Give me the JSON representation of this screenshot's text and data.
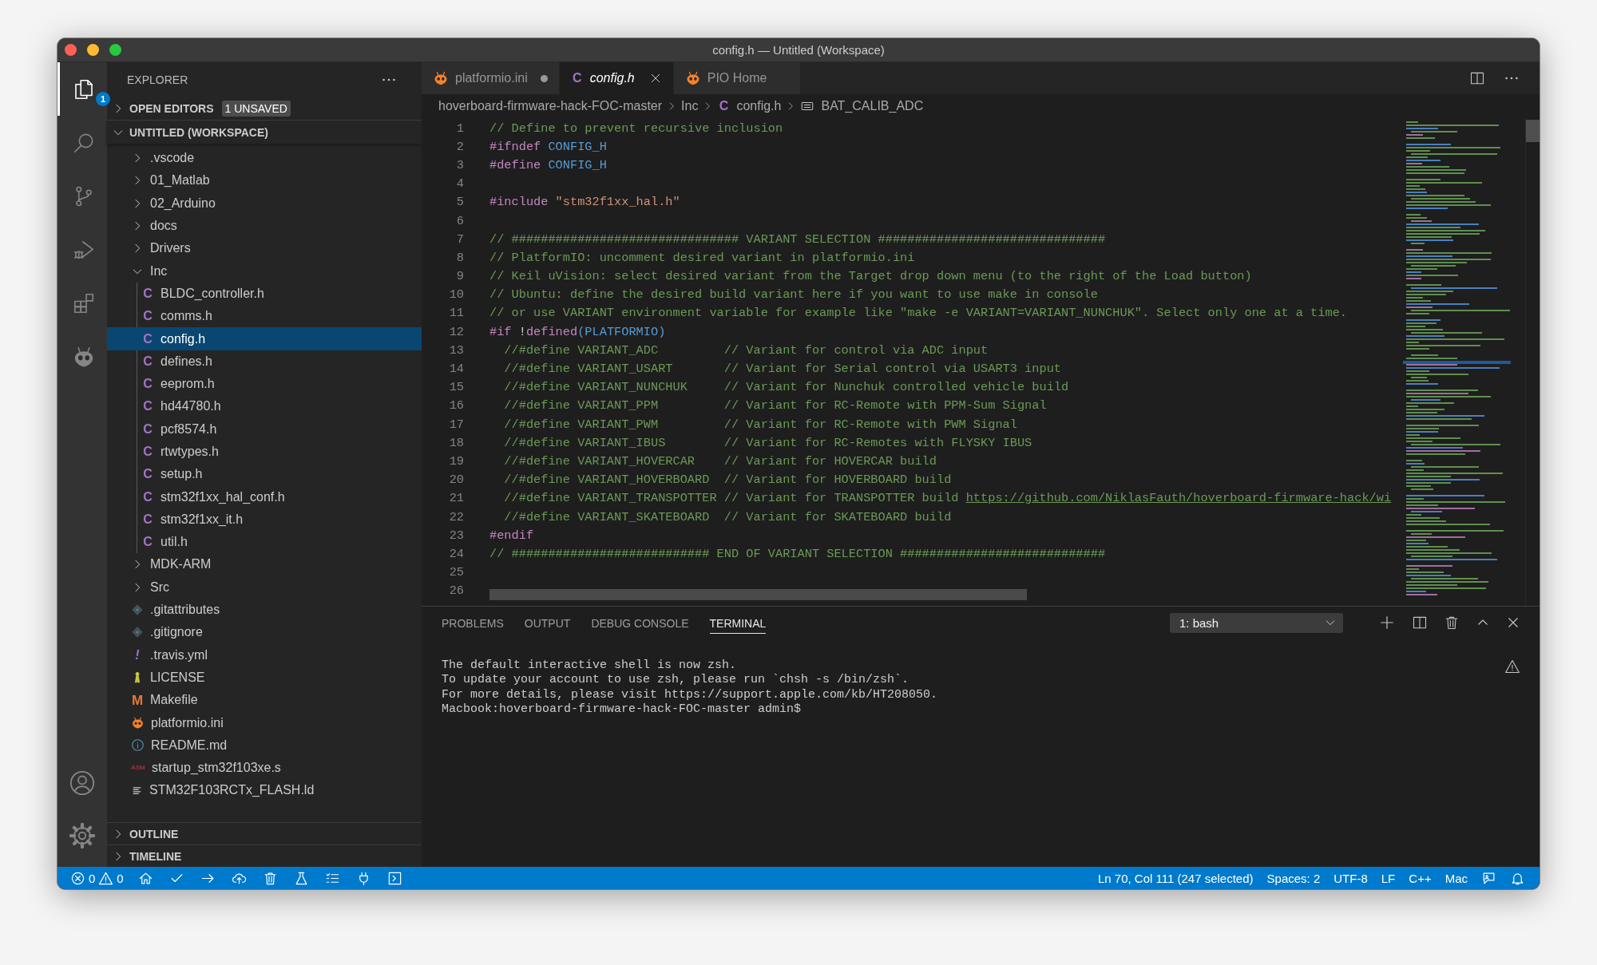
{
  "window": {
    "title": "config.h — Untitled (Workspace)"
  },
  "activity_bar": {
    "items": [
      {
        "kind": "files",
        "selected": true,
        "badge": "1"
      },
      {
        "kind": "search",
        "selected": false
      },
      {
        "kind": "branch",
        "selected": false
      },
      {
        "kind": "debug",
        "selected": false
      },
      {
        "kind": "extensions",
        "selected": false
      },
      {
        "kind": "alien",
        "selected": false
      }
    ],
    "bottom": [
      {
        "kind": "account"
      },
      {
        "kind": "gear"
      }
    ]
  },
  "sidebar": {
    "title": "EXPLORER",
    "open_editors": {
      "label": "OPEN EDITORS",
      "badge": "1 UNSAVED",
      "expanded": false
    },
    "workspace": {
      "label": "UNTITLED (WORKSPACE)",
      "expanded": true,
      "items": [
        {
          "kind": "folder",
          "label": ".vscode",
          "expanded": false,
          "selected": false
        },
        {
          "kind": "folder",
          "label": "01_Matlab",
          "expanded": false,
          "selected": false
        },
        {
          "kind": "folder",
          "label": "02_Arduino",
          "expanded": false,
          "selected": false
        },
        {
          "kind": "folder",
          "label": "docs",
          "expanded": false,
          "selected": false
        },
        {
          "kind": "folder",
          "label": "Drivers",
          "expanded": false,
          "selected": false
        },
        {
          "kind": "folder",
          "label": "Inc",
          "expanded": true,
          "selected": false,
          "children": [
            {
              "kind": "c",
              "glyph": "C",
              "label": "BLDC_controller.h",
              "selected": false
            },
            {
              "kind": "c",
              "glyph": "C",
              "label": "comms.h",
              "selected": false
            },
            {
              "kind": "c",
              "glyph": "C",
              "label": "config.h",
              "selected": true
            },
            {
              "kind": "c",
              "glyph": "C",
              "label": "defines.h",
              "selected": false
            },
            {
              "kind": "c",
              "glyph": "C",
              "label": "eeprom.h",
              "selected": false
            },
            {
              "kind": "c",
              "glyph": "C",
              "label": "hd44780.h",
              "selected": false
            },
            {
              "kind": "c",
              "glyph": "C",
              "label": "pcf8574.h",
              "selected": false
            },
            {
              "kind": "c",
              "glyph": "C",
              "label": "rtwtypes.h",
              "selected": false
            },
            {
              "kind": "c",
              "glyph": "C",
              "label": "setup.h",
              "selected": false
            },
            {
              "kind": "c",
              "glyph": "C",
              "label": "stm32f1xx_hal_conf.h",
              "selected": false
            },
            {
              "kind": "c",
              "glyph": "C",
              "label": "stm32f1xx_it.h",
              "selected": false
            },
            {
              "kind": "c",
              "glyph": "C",
              "label": "util.h",
              "selected": false
            }
          ]
        },
        {
          "kind": "folder",
          "label": "MDK-ARM",
          "expanded": false,
          "selected": false
        },
        {
          "kind": "folder",
          "label": "Src",
          "expanded": false,
          "selected": false
        },
        {
          "kind": "git",
          "label": ".gitattributes",
          "selected": false
        },
        {
          "kind": "git",
          "label": ".gitignore",
          "selected": false
        },
        {
          "kind": "yaml",
          "glyph": "!",
          "label": ".travis.yml",
          "selected": false
        },
        {
          "kind": "license",
          "label": "LICENSE",
          "selected": false
        },
        {
          "kind": "makefile",
          "glyph": "M",
          "label": "Makefile",
          "selected": false
        },
        {
          "kind": "platformio",
          "label": "platformio.ini",
          "selected": false
        },
        {
          "kind": "info",
          "label": "README.md",
          "selected": false
        },
        {
          "kind": "asm",
          "glyph": "ASM",
          "label": "startup_stm32f103xe.s",
          "selected": false
        },
        {
          "kind": "linker",
          "label": "STM32F103RCTx_FLASH.ld",
          "selected": false
        }
      ]
    },
    "sections": [
      {
        "label": "OUTLINE",
        "expanded": false
      },
      {
        "label": "TIMELINE",
        "expanded": false
      }
    ]
  },
  "editor": {
    "tabs": [
      {
        "label": "platformio.ini",
        "kind": "platformio",
        "dirty": true,
        "selected": false
      },
      {
        "label": "config.h",
        "kind": "c",
        "glyph": "C",
        "dirty": false,
        "selected": true
      },
      {
        "label": "PIO Home",
        "kind": "platformio",
        "dirty": false,
        "selected": false
      }
    ],
    "breadcrumb": [
      {
        "kind": "folder",
        "label": "hoverboard-firmware-hack-FOC-master"
      },
      {
        "kind": "folder",
        "label": "Inc"
      },
      {
        "kind": "file",
        "glyph": "C",
        "label": "config.h"
      },
      {
        "kind": "symbol",
        "label": "BAT_CALIB_ADC"
      }
    ],
    "code": [
      {
        "number": "1",
        "tokens": [
          {
            "kind": "comment",
            "text": "// Define to prevent recursive inclusion"
          }
        ]
      },
      {
        "number": "2",
        "tokens": [
          {
            "kind": "directive",
            "text": "#ifndef"
          },
          {
            "kind": "macro",
            "text": " CONFIG_H"
          }
        ]
      },
      {
        "number": "3",
        "tokens": [
          {
            "kind": "directive",
            "text": "#define"
          },
          {
            "kind": "macro",
            "text": " CONFIG_H"
          }
        ]
      },
      {
        "number": "4"
      },
      {
        "number": "5",
        "tokens": [
          {
            "kind": "directive",
            "text": "#include"
          },
          {
            "kind": "string",
            "text": " \"stm32f1xx_hal.h\""
          }
        ]
      },
      {
        "number": "6"
      },
      {
        "number": "7",
        "tokens": [
          {
            "kind": "comment",
            "text": "// ############################### VARIANT SELECTION ###############################"
          }
        ]
      },
      {
        "number": "8",
        "tokens": [
          {
            "kind": "comment",
            "text": "// PlatformIO: uncomment desired variant in platformio.ini"
          }
        ]
      },
      {
        "number": "9",
        "tokens": [
          {
            "kind": "comment",
            "text": "// Keil uVision: select desired variant from the Target drop down menu (to the right of the Load button)"
          }
        ]
      },
      {
        "number": "10",
        "tokens": [
          {
            "kind": "comment",
            "text": "// Ubuntu: define the desired build variant here if you want to use make in console"
          }
        ]
      },
      {
        "number": "11",
        "tokens": [
          {
            "kind": "comment",
            "text": "// or use VARIANT environment variable for example like \"make -e VARIANT=VARIANT_NUNCHUK\". Select only one at a time."
          }
        ]
      },
      {
        "number": "12",
        "tokens": [
          {
            "kind": "directive",
            "text": "#if"
          },
          {
            "kind": "plain",
            "text": " !"
          },
          {
            "kind": "directive",
            "text": "defined"
          },
          {
            "kind": "macro",
            "text": "(PLATFORMIO)"
          }
        ]
      },
      {
        "number": "13",
        "tokens": [
          {
            "kind": "comment",
            "text": "  //#define VARIANT_ADC         // Variant for control via ADC input"
          }
        ]
      },
      {
        "number": "14",
        "tokens": [
          {
            "kind": "comment",
            "text": "  //#define VARIANT_USART       // Variant for Serial control via USART3 input"
          }
        ]
      },
      {
        "number": "15",
        "tokens": [
          {
            "kind": "comment",
            "text": "  //#define VARIANT_NUNCHUK     // Variant for Nunchuk controlled vehicle build"
          }
        ]
      },
      {
        "number": "16",
        "tokens": [
          {
            "kind": "comment",
            "text": "  //#define VARIANT_PPM         // Variant for RC-Remote with PPM-Sum Signal"
          }
        ]
      },
      {
        "number": "17",
        "tokens": [
          {
            "kind": "comment",
            "text": "  //#define VARIANT_PWM         // Variant for RC-Remote with PWM Signal"
          }
        ]
      },
      {
        "number": "18",
        "tokens": [
          {
            "kind": "comment",
            "text": "  //#define VARIANT_IBUS        // Variant for RC-Remotes with FLYSKY IBUS"
          }
        ]
      },
      {
        "number": "19",
        "tokens": [
          {
            "kind": "comment",
            "text": "  //#define VARIANT_HOVERCAR    // Variant for HOVERCAR build"
          }
        ]
      },
      {
        "number": "20",
        "tokens": [
          {
            "kind": "comment",
            "text": "  //#define VARIANT_HOVERBOARD  // Variant for HOVERBOARD build"
          }
        ]
      },
      {
        "number": "21",
        "tokens": [
          {
            "kind": "comment",
            "text": "  //#define VARIANT_TRANSPOTTER // Variant for TRANSPOTTER build "
          },
          {
            "kind": "link",
            "text": "https://github.com/NiklasFauth/hoverboard-firmware-hack/wi"
          }
        ]
      },
      {
        "number": "22",
        "tokens": [
          {
            "kind": "comment",
            "text": "  //#define VARIANT_SKATEBOARD  // Variant for SKATEBOARD build"
          }
        ]
      },
      {
        "number": "23",
        "tokens": [
          {
            "kind": "directive",
            "text": "#endif"
          }
        ]
      },
      {
        "number": "24",
        "tokens": [
          {
            "kind": "comment",
            "text": "// ########################### END OF VARIANT SELECTION ############################"
          }
        ]
      },
      {
        "number": "25"
      },
      {
        "number": "26"
      }
    ]
  },
  "panel": {
    "tabs": [
      {
        "label": "PROBLEMS",
        "selected": false
      },
      {
        "label": "OUTPUT",
        "selected": false
      },
      {
        "label": "DEBUG CONSOLE",
        "selected": false
      },
      {
        "label": "TERMINAL",
        "selected": true
      }
    ],
    "terminal_selector": "1: bash",
    "terminal_lines": [
      "The default interactive shell is now zsh.",
      "To update your account to use zsh, please run `chsh -s /bin/zsh`.",
      "For more details, please visit https://support.apple.com/kb/HT208050.",
      "Macbook:hoverboard-firmware-hack-FOC-master admin$"
    ]
  },
  "status_bar": {
    "errors": "0",
    "warnings": "0",
    "tools": [
      {
        "kind": "home"
      },
      {
        "kind": "check"
      },
      {
        "kind": "arrow"
      },
      {
        "kind": "cloud"
      },
      {
        "kind": "trash"
      },
      {
        "kind": "flask"
      },
      {
        "kind": "list"
      },
      {
        "kind": "plug"
      },
      {
        "kind": "terminal"
      }
    ],
    "right": [
      "Ln 70, Col 111 (247 selected)",
      "Spaces: 2",
      "UTF-8",
      "LF",
      "C++",
      "Mac"
    ]
  }
}
